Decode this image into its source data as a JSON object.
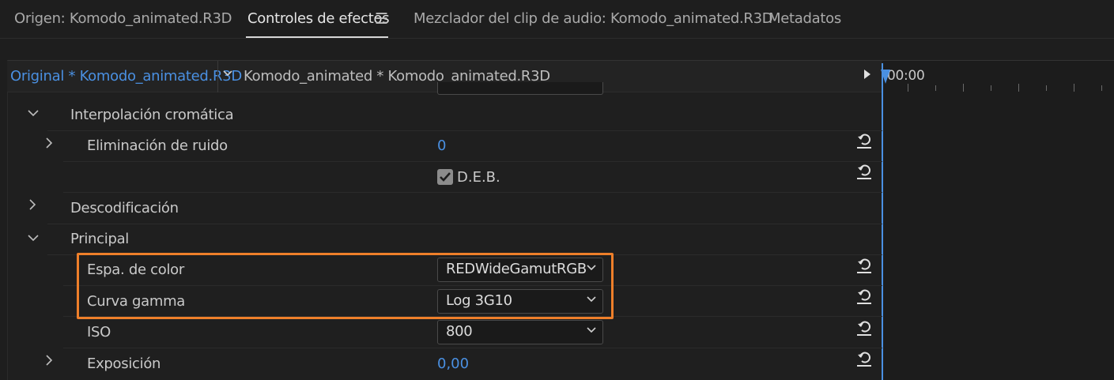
{
  "tabs": [
    {
      "label": "Origen: Komodo_animated.R3D",
      "active": false
    },
    {
      "label": "Controles de efectos",
      "active": true
    },
    {
      "label": "Mezclador del clip de audio: Komodo_animated.R3D",
      "active": false
    },
    {
      "label": "Metadatos",
      "active": false
    }
  ],
  "menu_icon": "☰",
  "source": {
    "master_label": "Original * Komodo_animated.R3D",
    "clip_label": "Komodo_animated * Komodo_animated.R3D"
  },
  "timeline": {
    "timecode": "00:00"
  },
  "sections": {
    "interpolacion": "Interpolación cromática",
    "eliminacion": "Eliminación de ruido",
    "eliminacion_value": "0",
    "deb_label": "D.E.B.",
    "deb_checked": true,
    "descodificacion": "Descodificación",
    "principal": "Principal",
    "espa_color": "Espa. de color",
    "espa_color_value": "REDWideGamutRGB",
    "curva_gamma": "Curva gamma",
    "curva_gamma_value": "Log 3G10",
    "iso": "ISO",
    "iso_value": "800",
    "exposicion": "Exposición",
    "exposicion_value": "0,00"
  },
  "colors": {
    "accent_blue": "#4a90e2",
    "highlight_orange": "#ee7f2a"
  },
  "icons": {
    "reset": "reset-icon",
    "expand": "chevron-right-icon",
    "collapse": "chevron-down-icon"
  }
}
